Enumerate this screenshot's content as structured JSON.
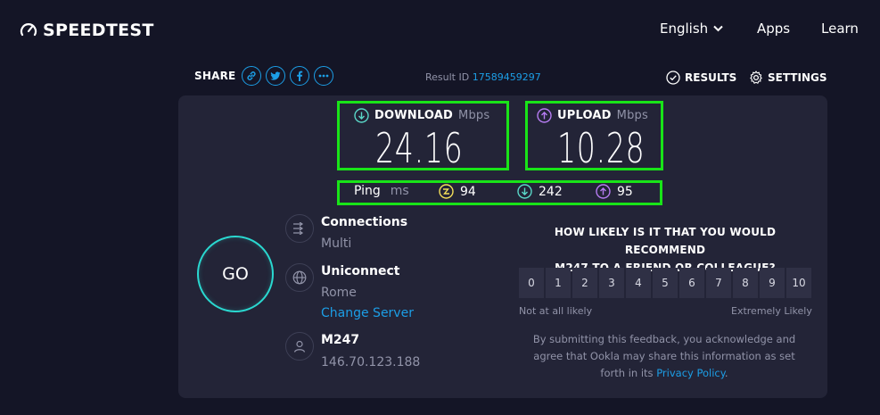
{
  "header": {
    "logo_text": "SPEEDTEST",
    "nav": {
      "language": "English",
      "apps": "Apps",
      "learn": "Learn"
    }
  },
  "share": {
    "label": "SHARE",
    "icons": [
      "link-icon",
      "twitter-icon",
      "facebook-icon",
      "more-icon"
    ],
    "result_label": "Result ID",
    "result_id": "17589459297",
    "results_label": "RESULTS",
    "settings_label": "SETTINGS"
  },
  "download": {
    "label": "DOWNLOAD",
    "unit": "Mbps",
    "value": "24.16"
  },
  "upload": {
    "label": "UPLOAD",
    "unit": "Mbps",
    "value": "10.28"
  },
  "ping": {
    "label": "Ping",
    "unit": "ms",
    "idle": "94",
    "download": "242",
    "upload": "95"
  },
  "go_label": "GO",
  "connections": {
    "title": "Connections",
    "value": "Multi"
  },
  "server": {
    "title": "Uniconnect",
    "location": "Rome",
    "change_label": "Change Server"
  },
  "provider": {
    "title": "M247",
    "ip": "146.70.123.188"
  },
  "survey": {
    "question_line1": "HOW LIKELY IS IT THAT YOU WOULD RECOMMEND",
    "question_line2": "M247 TO A FRIEND OR COLLEAGUE?",
    "scale": [
      "0",
      "1",
      "2",
      "3",
      "4",
      "5",
      "6",
      "7",
      "8",
      "9",
      "10"
    ],
    "low_label": "Not at all likely",
    "high_label": "Extremely Likely",
    "disclaimer_line1": "By submitting this feedback, you acknowledge and",
    "disclaimer_line2": "agree that Ookla may share this information as set",
    "disclaimer_line3_prefix": "forth in its",
    "privacy_link": "Privacy Policy",
    "disclaimer_line3_suffix": "."
  },
  "colors": {
    "background": "#141526",
    "panel": "#232437",
    "accent_blue": "#1c9ee6",
    "go_ring": "#2ad8d0",
    "download_icon": "#5ad7c8",
    "upload_icon": "#b67cf2",
    "idle_icon": "#f5e05a",
    "highlight": "#19e418"
  }
}
